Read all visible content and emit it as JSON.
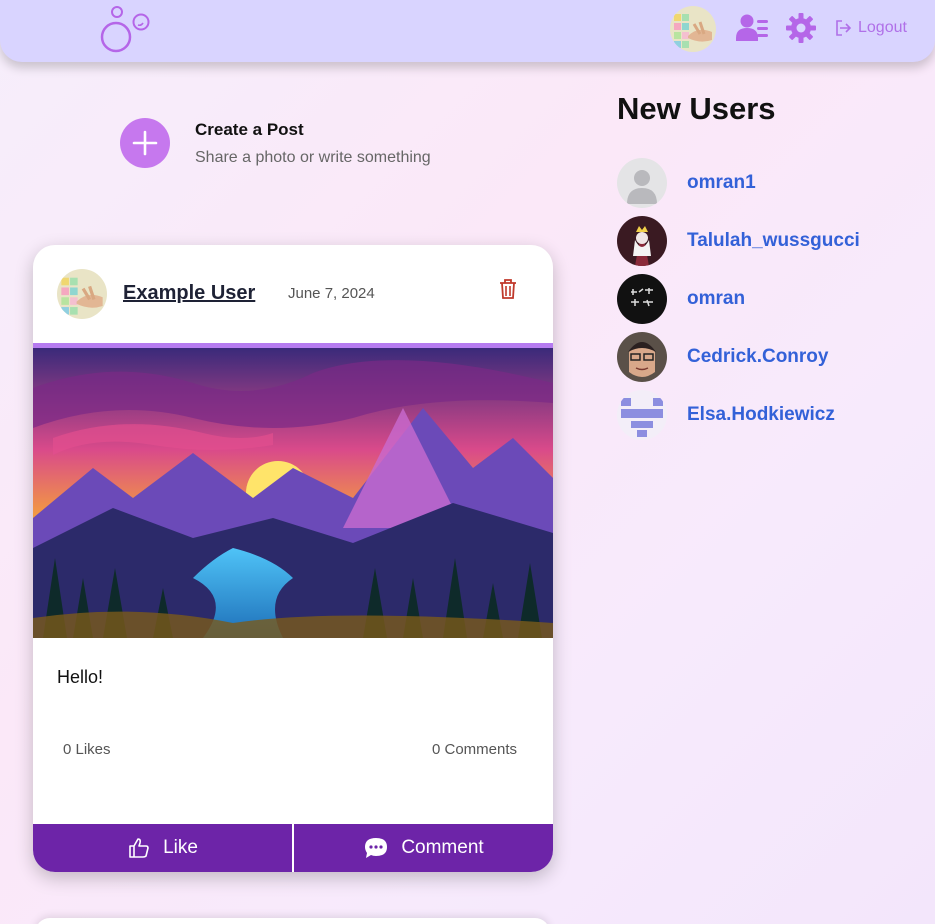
{
  "nav": {
    "logout_label": "Logout"
  },
  "create_post": {
    "title": "Create a Post",
    "subtitle": "Share a photo or write something"
  },
  "post": {
    "username": "Example User",
    "date": "June 7, 2024",
    "text": "Hello!",
    "likes": "0 Likes",
    "comments": "0 Comments",
    "like_label": "Like",
    "comment_label": "Comment"
  },
  "new_users": {
    "title": "New Users",
    "users": [
      {
        "name": "omran1"
      },
      {
        "name": "Talulah_wussgucci"
      },
      {
        "name": "omran"
      },
      {
        "name": "Cedrick.Conroy"
      },
      {
        "name": "Elsa.Hodkiewicz"
      }
    ]
  },
  "colors": {
    "topbar": "#d9d4ff",
    "accent_purple": "#6d24a8",
    "link_blue": "#3361d8",
    "icon_purple": "#b070e8"
  }
}
